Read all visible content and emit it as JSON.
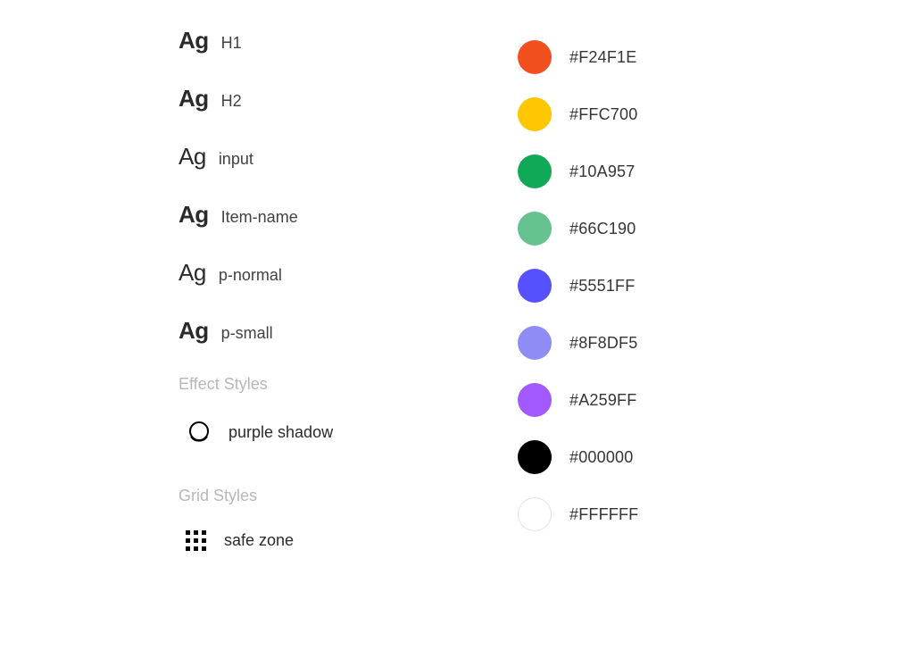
{
  "typography": {
    "sample_glyph": "Ag",
    "styles": [
      {
        "label": "H1",
        "sample_weight": "w700"
      },
      {
        "label": "H2",
        "sample_weight": "w700"
      },
      {
        "label": "input",
        "sample_weight": "w400"
      },
      {
        "label": "Item-name",
        "sample_weight": "w600"
      },
      {
        "label": "p-normal",
        "sample_weight": "w400"
      },
      {
        "label": "p-small",
        "sample_weight": "w700"
      }
    ]
  },
  "effects": {
    "heading": "Effect Styles",
    "items": [
      {
        "label": "purple shadow"
      }
    ]
  },
  "grids": {
    "heading": "Grid Styles",
    "items": [
      {
        "label": "safe zone"
      }
    ]
  },
  "colors": [
    {
      "hex": "#F24F1E"
    },
    {
      "hex": "#FFC700"
    },
    {
      "hex": "#10A957"
    },
    {
      "hex": "#66C190"
    },
    {
      "hex": "#5551FF"
    },
    {
      "hex": "#8F8DF5"
    },
    {
      "hex": "#A259FF"
    },
    {
      "hex": "#000000"
    },
    {
      "hex": "#FFFFFF",
      "outline": true
    }
  ]
}
